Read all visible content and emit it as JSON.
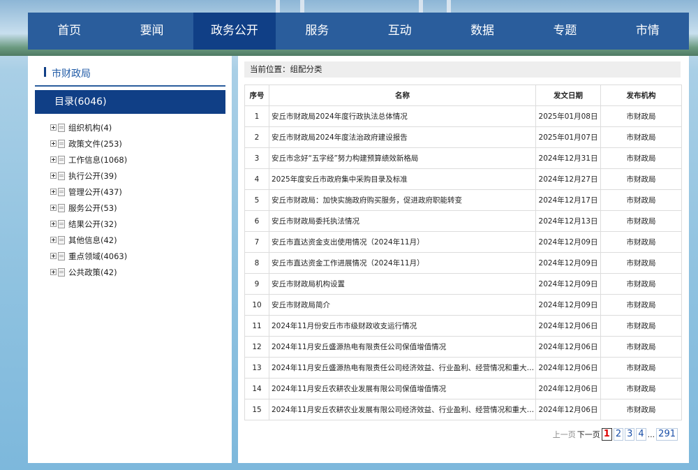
{
  "nav": {
    "items": [
      "首页",
      "要闻",
      "政务公开",
      "服务",
      "互动",
      "数据",
      "专题",
      "市情"
    ],
    "active_index": 2
  },
  "sidebar": {
    "org_title": "市财政局",
    "catalog_label": "目录(6046)",
    "tree": [
      "组织机构(4)",
      "政策文件(253)",
      "工作信息(1068)",
      "执行公开(39)",
      "管理公开(437)",
      "服务公开(53)",
      "结果公开(32)",
      "其他信息(42)",
      "重点领域(4063)",
      "公共政策(42)"
    ]
  },
  "main": {
    "breadcrumb": "当前位置：组配分类",
    "columns": [
      "序号",
      "名称",
      "发文日期",
      "发布机构"
    ],
    "rows": [
      [
        "1",
        "安丘市财政局2024年度行政执法总体情况",
        "2025年01月08日",
        "市财政局"
      ],
      [
        "2",
        "安丘市财政局2024年度法治政府建设报告",
        "2025年01月07日",
        "市财政局"
      ],
      [
        "3",
        "安丘市念好“五字经”努力构建预算绩效新格局",
        "2024年12月31日",
        "市财政局"
      ],
      [
        "4",
        "2025年度安丘市政府集中采购目录及标准",
        "2024年12月27日",
        "市财政局"
      ],
      [
        "5",
        "安丘市财政局：加快实施政府购买服务，促进政府职能转变",
        "2024年12月17日",
        "市财政局"
      ],
      [
        "6",
        "安丘市财政局委托执法情况",
        "2024年12月13日",
        "市财政局"
      ],
      [
        "7",
        "安丘市直达资金支出使用情况（2024年11月）",
        "2024年12月09日",
        "市财政局"
      ],
      [
        "8",
        "安丘市直达资金工作进展情况（2024年11月）",
        "2024年12月09日",
        "市财政局"
      ],
      [
        "9",
        "安丘市财政局机构设置",
        "2024年12月09日",
        "市财政局"
      ],
      [
        "10",
        "安丘市财政局简介",
        "2024年12月09日",
        "市财政局"
      ],
      [
        "11",
        "2024年11月份安丘市市级财政收支运行情况",
        "2024年12月06日",
        "市财政局"
      ],
      [
        "12",
        "2024年11月安丘盛源热电有限责任公司保值增值情况",
        "2024年12月06日",
        "市财政局"
      ],
      [
        "13",
        "2024年11月安丘盛源热电有限责任公司经济效益、行业盈利、经营情况和重大变...",
        "2024年12月06日",
        "市财政局"
      ],
      [
        "14",
        "2024年11月安丘农耕农业发展有限公司保值增值情况",
        "2024年12月06日",
        "市财政局"
      ],
      [
        "15",
        "2024年11月安丘农耕农业发展有限公司经济效益、行业盈利、经营情况和重大变...",
        "2024年12月06日",
        "市财政局"
      ]
    ]
  },
  "pager": {
    "prev": "上一页",
    "next": "下一页",
    "current": "1",
    "pages": [
      "2",
      "3",
      "4"
    ],
    "ellipsis": "...",
    "last": "291"
  }
}
